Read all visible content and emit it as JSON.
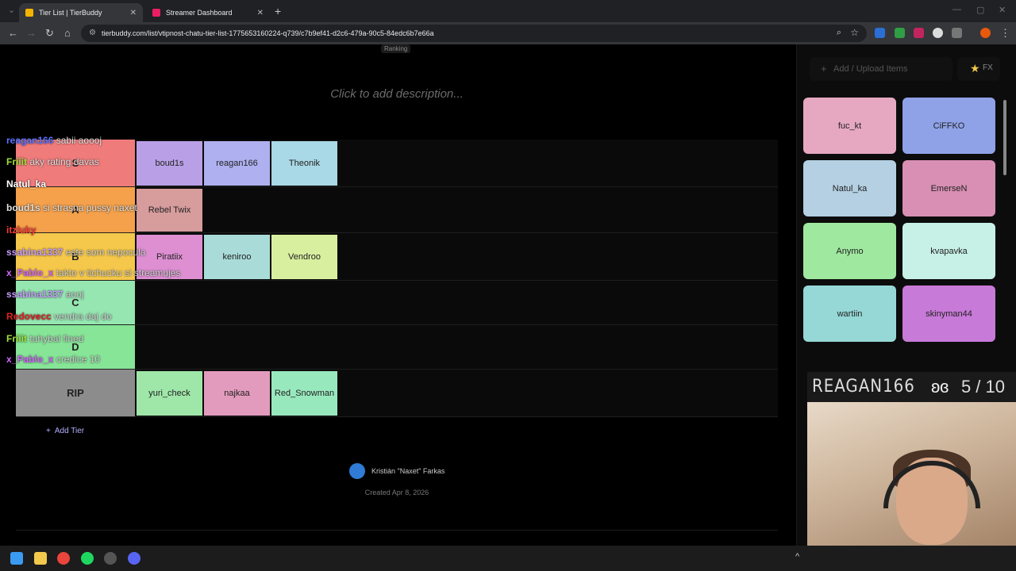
{
  "browser": {
    "tabs": [
      {
        "label": "Tier List | TierBuddy",
        "color": "#f4b400"
      },
      {
        "label": "Streamer Dashboard",
        "color": "#e91e63"
      }
    ],
    "close_glyph": "✕",
    "new_tab_glyph": "+",
    "url": "tierbuddy.com/list/vtipnost-chatu-tier-list-1775653160224-q739/c7b9ef41-d2c6-479a-90c5-84edc6b7e66a"
  },
  "page": {
    "ranking": "Ranking",
    "description_placeholder": "Click to add description...",
    "add_tier": "Add Tier",
    "add_tier_glyph": "+",
    "creator": "Kristián \"Naxet\" Farkas",
    "created": "Created Apr 8, 2026"
  },
  "tiers": [
    {
      "label": "S",
      "color": "#f07b7b",
      "items": [
        {
          "name": "boud1s",
          "color": "#b9a0e6"
        },
        {
          "name": "reagan166",
          "color": "#aeb0ef"
        },
        {
          "name": "Theonik",
          "color": "#a9d8e6"
        }
      ]
    },
    {
      "label": "A",
      "color": "#f5a04a",
      "items": [
        {
          "name": "Rebel Twix",
          "color": "#d79c9c"
        }
      ]
    },
    {
      "label": "B",
      "color": "#f5c84b",
      "items": [
        {
          "name": "Piratiix",
          "color": "#dd8fd2"
        },
        {
          "name": "keniroo",
          "color": "#a9dcd8"
        },
        {
          "name": "Vendroo",
          "color": "#d8ef9f"
        }
      ]
    },
    {
      "label": "C",
      "color": "#95e6b1",
      "items": []
    },
    {
      "label": "D",
      "color": "#86e597",
      "items": []
    },
    {
      "label": "RIP",
      "color": "#8c8c8c",
      "items": [
        {
          "name": "yuri_check",
          "color": "#9fe6a9"
        },
        {
          "name": "najkaa",
          "color": "#e39bbd"
        },
        {
          "name": "Red_Snowman",
          "color": "#98e8bd"
        }
      ]
    }
  ],
  "sidebar": {
    "upload_label": "Add / Upload Items",
    "upload_glyph": "+",
    "fx_label": "FX",
    "fx_glyph": "★",
    "items": [
      {
        "name": "fuc_kt",
        "color": "#e6a8c1"
      },
      {
        "name": "CiFFKO",
        "color": "#8fa2e8"
      },
      {
        "name": "Natul_ka",
        "color": "#b4d0e2"
      },
      {
        "name": "EmerseN",
        "color": "#d88fb3"
      },
      {
        "name": "Anymo",
        "color": "#9fe89f"
      },
      {
        "name": "kvapavka",
        "color": "#c7f0e6"
      },
      {
        "name": "wartiin",
        "color": "#95d8d6"
      },
      {
        "name": "skinyman44",
        "color": "#c87ad8"
      }
    ]
  },
  "chat": [
    {
      "user": "reagan166",
      "user_color": "#5b74ff",
      "text": "sabii aoooj",
      "text_color": "#e0e0e0"
    },
    {
      "user": "Friiit",
      "user_color": "#9fe03c",
      "text": "aky rating davas",
      "text_color": "#e0e0e0"
    },
    {
      "user": "Natul_ka",
      "user_color": "#ffffff",
      "text": "",
      "text_color": "#e0e0e0"
    },
    {
      "user": "boud1s",
      "user_color": "#e0e0e0",
      "text": "si strasna pussy naxet",
      "text_color": "#e0e0e0"
    },
    {
      "user": "itzluky",
      "user_color": "#ff3b3b",
      "text": "",
      "text_color": "#e0e0e0"
    },
    {
      "user": "ssabina1337",
      "user_color": "#c79cff",
      "text": "este som nepocula",
      "text_color": "#d0d0d0"
    },
    {
      "user": "x_Pablo_x",
      "user_color": "#d466ff",
      "text": "takto v tichucku si streamujes",
      "text_color": "#d0d0d0"
    },
    {
      "user": "ssabina1337",
      "user_color": "#c79cff",
      "text": "aooj",
      "text_color": "#d0d0d0"
    },
    {
      "user": "Redovecc",
      "user_color": "#e02020",
      "text": "vendra daj do",
      "text_color": "#d0d0d0"
    },
    {
      "user": "Friiit",
      "user_color": "#9fe03c",
      "text": "tahybal fined",
      "text_color": "#d0d0d0"
    },
    {
      "user": "x_Pablo_x",
      "user_color": "#d466ff",
      "text": "credice 10",
      "text_color": "#d0d0d0"
    }
  ],
  "overlay": {
    "name": "REAGAN166",
    "score": "5 / 10",
    "butterfly_icon": "butterfly-icon"
  }
}
